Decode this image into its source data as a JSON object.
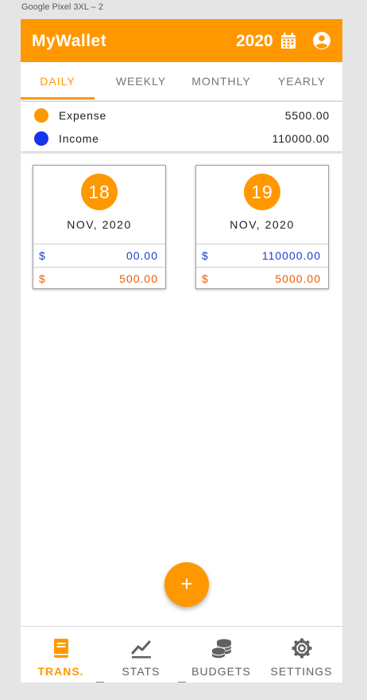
{
  "frame_label": "Google Pixel 3XL – 2",
  "appbar": {
    "title": "MyWallet",
    "year": "2020",
    "calendar_icon": "calendar-icon",
    "account_icon": "account-circle-icon",
    "color": "#ff9800"
  },
  "tabs": [
    {
      "label": "DAILY",
      "active": true
    },
    {
      "label": "WEEKLY",
      "active": false
    },
    {
      "label": "MONTHLY",
      "active": false
    },
    {
      "label": "YEARLY",
      "active": false
    }
  ],
  "summary": {
    "expense": {
      "label": "Expense",
      "value": "5500.00",
      "color": "#ff9800"
    },
    "income": {
      "label": "Income",
      "value": "110000.00",
      "color": "#1634ea"
    }
  },
  "days": [
    {
      "day": "18",
      "month": "NOV, 2020",
      "income_currency": "$",
      "income": "00.00",
      "expense_currency": "$",
      "expense": "500.00"
    },
    {
      "day": "19",
      "month": "NOV, 2020",
      "income_currency": "$",
      "income": "110000.00",
      "expense_currency": "$",
      "expense": "5000.00"
    }
  ],
  "fab": {
    "label": "+",
    "icon": "add-icon"
  },
  "bottom_nav": [
    {
      "label": "TRANS.",
      "icon": "book-icon",
      "active": true
    },
    {
      "label": "STATS",
      "icon": "stats-icon",
      "active": false
    },
    {
      "label": "BUDGETS",
      "icon": "coins-icon",
      "active": false
    },
    {
      "label": "SETTINGS",
      "icon": "gear-icon",
      "active": false
    }
  ]
}
